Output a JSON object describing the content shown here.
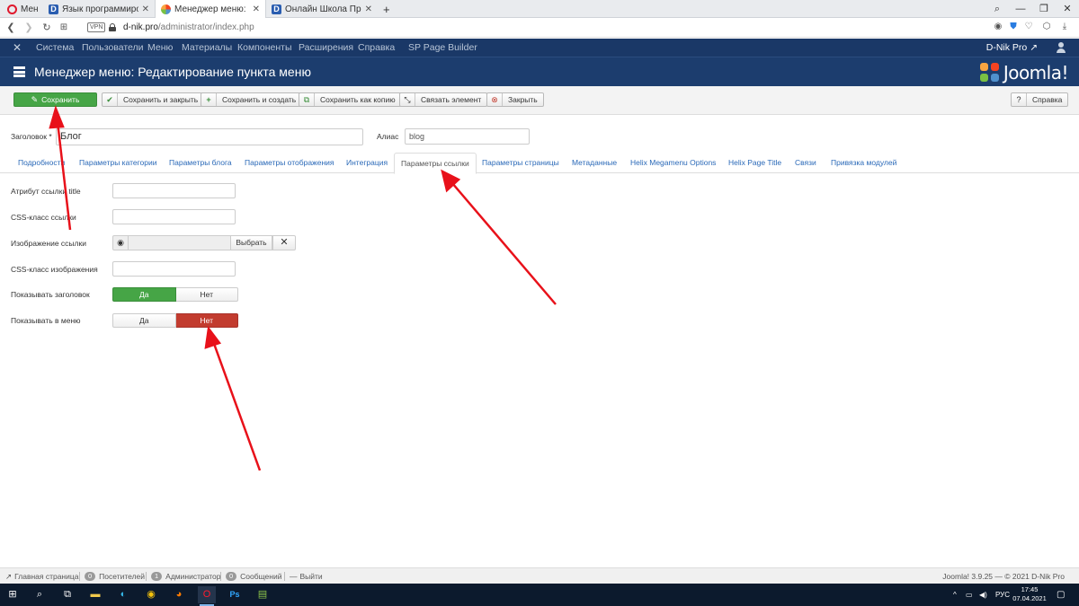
{
  "browser": {
    "tabs": [
      {
        "label": "Меню",
        "icon": "opera-icon"
      },
      {
        "label": "Язык программирования",
        "icon": "d-nik-favicon"
      },
      {
        "label": "Менеджер меню: Редакти",
        "icon": "joomla-favicon",
        "active": true
      },
      {
        "label": "Онлайн Школа Програми",
        "icon": "d-nik-favicon"
      }
    ],
    "new_tab": "+",
    "vpn": "VPN",
    "url_host": "d-nik.pro",
    "url_path": "/administrator/index.php"
  },
  "admin_nav": {
    "items": [
      "Система",
      "Пользователи",
      "Меню",
      "Материалы",
      "Компоненты",
      "Расширения",
      "Справка",
      "SP Page Builder"
    ],
    "user": "D-Nik Pro"
  },
  "header": {
    "title": "Менеджер меню: Редактирование пункта меню",
    "logo_text": "Joomla!"
  },
  "toolbar": {
    "save": "Сохранить",
    "save_close": "Сохранить и закрыть",
    "save_new": "Сохранить и создать",
    "save_copy": "Сохранить как копию",
    "associate": "Связать элемент",
    "close": "Закрыть",
    "help": "Справка"
  },
  "form": {
    "title_label": "Заголовок *",
    "title_value": "Блог",
    "alias_label": "Алиас",
    "alias_value": "blog"
  },
  "tabs": [
    "Подробности",
    "Параметры категории",
    "Параметры блога",
    "Параметры отображения",
    "Интеграция",
    "Параметры ссылки",
    "Параметры страницы",
    "Метаданные",
    "Helix Megamenu Options",
    "Helix Page Title",
    "Связи",
    "Привязка модулей"
  ],
  "active_tab": "Параметры ссылки",
  "link_params": {
    "title_attr_label": "Атрибут ссылки title",
    "css_class_label": "CSS-класс ссылки",
    "image_label": "Изображение ссылки",
    "image_select": "Выбрать",
    "image_clear": "✕",
    "image_css_label": "CSS-класс изображения",
    "show_title_label": "Показывать заголовок",
    "show_title_value": "Да",
    "show_menu_label": "Показывать в меню",
    "show_menu_value": "Нет",
    "yes": "Да",
    "no": "Нет"
  },
  "status": {
    "home": "Главная страница",
    "visitors_count": "0",
    "visitors": "Посетителей",
    "admins_count": "1",
    "admins": "Администратор",
    "messages_count": "0",
    "messages": "Сообщений",
    "logout": "Выйти",
    "version": "Joomla! 3.9.25 — © 2021 D-Nik Pro"
  },
  "taskbar": {
    "lang": "РУС",
    "time": "17:45",
    "date": "07.04.2021"
  },
  "colors": {
    "admin_nav": "#1a3867",
    "header": "#1c3d6e",
    "save_green": "#46a546",
    "no_red": "#c23c2f",
    "arrow_red": "#e8111a",
    "link_blue": "#2a69b8"
  }
}
